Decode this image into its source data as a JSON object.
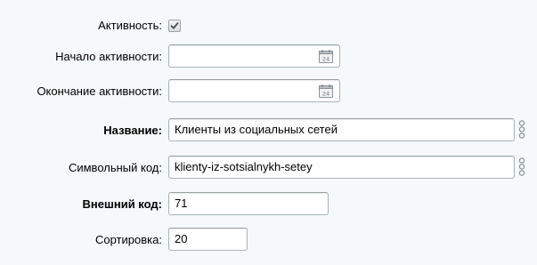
{
  "form": {
    "active": {
      "label": "Активность:",
      "checked": true
    },
    "active_from": {
      "label": "Начало активности:",
      "value": "",
      "calendar_day": "24"
    },
    "active_to": {
      "label": "Окончание активности:",
      "value": "",
      "calendar_day": "24"
    },
    "name": {
      "label": "Название:",
      "value": "Клиенты из социальных сетей"
    },
    "code": {
      "label": "Символьный код:",
      "value": "klienty-iz-sotsialnykh-setey"
    },
    "xml_id": {
      "label": "Внешний код:",
      "value": "71"
    },
    "sort": {
      "label": "Сортировка:",
      "value": "20"
    }
  },
  "icons": {
    "checkbox_mark": "check-icon",
    "calendar": "calendar-icon",
    "translit": "translit-chain-icon"
  },
  "colors": {
    "background": "#f5f9f9",
    "field_border": "#a8b4b7",
    "icon_gray": "#8a9396"
  }
}
